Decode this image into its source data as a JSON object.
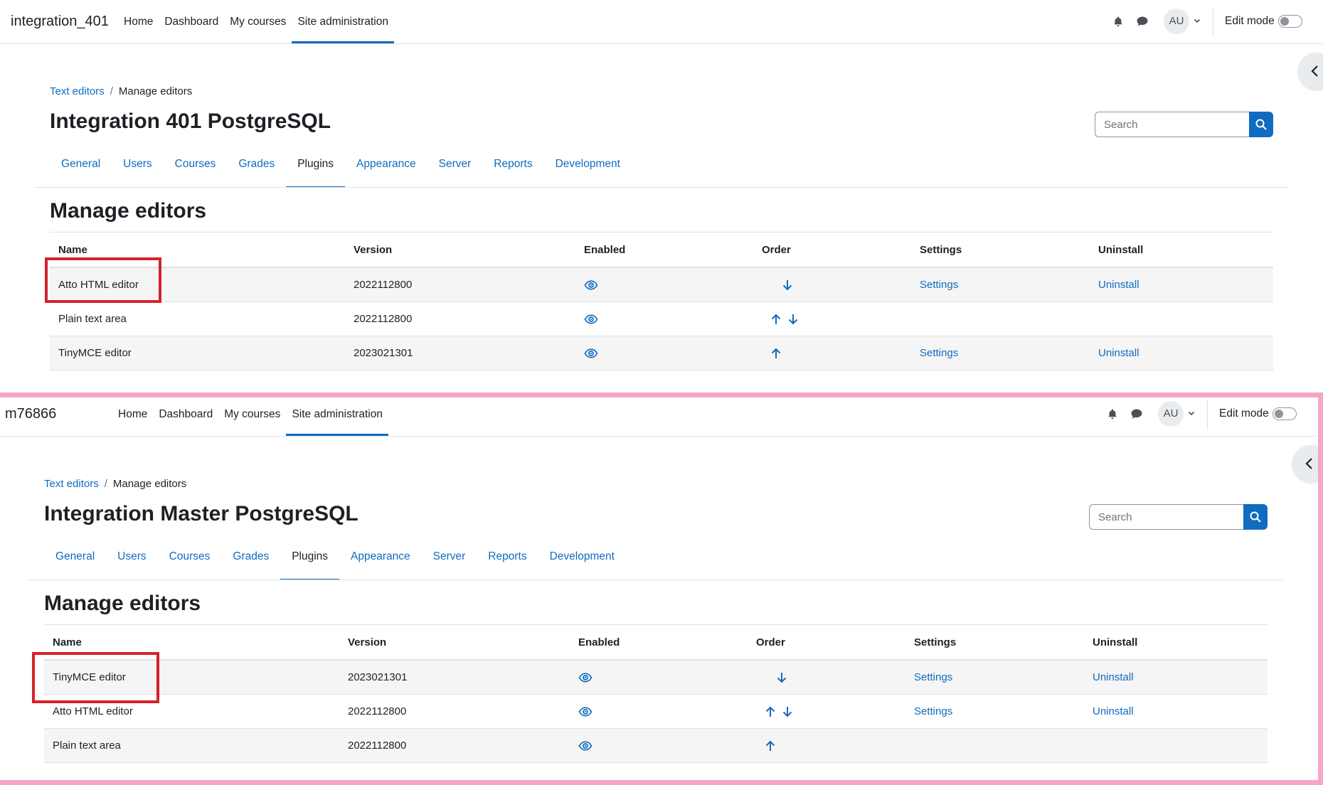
{
  "colors": {
    "accent": "#0f6cbf",
    "highlight": "#d6222a",
    "panel_border": "#f5a6c8",
    "stripe": "#f5f5f5"
  },
  "panels": [
    {
      "brand": "integration_401",
      "nav": {
        "items": [
          {
            "label": "Home"
          },
          {
            "label": "Dashboard"
          },
          {
            "label": "My courses"
          },
          {
            "label": "Site administration",
            "active": true
          }
        ]
      },
      "user_initials": "AU",
      "edit_mode_label": "Edit mode",
      "breadcrumb": {
        "parent": "Text editors",
        "separator": "/",
        "current": "Manage editors"
      },
      "page_title": "Integration 401 PostgreSQL",
      "search_placeholder": "Search",
      "tabs": [
        "General",
        "Users",
        "Courses",
        "Grades",
        "Plugins",
        "Appearance",
        "Server",
        "Reports",
        "Development"
      ],
      "active_tab": "Plugins",
      "section_title": "Manage editors",
      "table": {
        "headers": [
          "Name",
          "Version",
          "Enabled",
          "Order",
          "Settings",
          "Uninstall"
        ],
        "rows": [
          {
            "name": "Atto HTML editor",
            "version": "2022112800",
            "enabled_icon": "eye-icon",
            "order": [
              "down"
            ],
            "settings": "Settings",
            "uninstall": "Uninstall",
            "highlighted": true
          },
          {
            "name": "Plain text area",
            "version": "2022112800",
            "enabled_icon": "eye-icon",
            "order": [
              "up",
              "down"
            ],
            "settings": "",
            "uninstall": ""
          },
          {
            "name": "TinyMCE editor",
            "version": "2023021301",
            "enabled_icon": "eye-icon",
            "order": [
              "up"
            ],
            "settings": "Settings",
            "uninstall": "Uninstall"
          }
        ]
      }
    },
    {
      "brand": "m76866",
      "nav": {
        "items": [
          {
            "label": "Home"
          },
          {
            "label": "Dashboard"
          },
          {
            "label": "My courses"
          },
          {
            "label": "Site administration",
            "active": true
          }
        ]
      },
      "user_initials": "AU",
      "edit_mode_label": "Edit mode",
      "breadcrumb": {
        "parent": "Text editors",
        "separator": "/",
        "current": "Manage editors"
      },
      "page_title": "Integration Master PostgreSQL",
      "search_placeholder": "Search",
      "tabs": [
        "General",
        "Users",
        "Courses",
        "Grades",
        "Plugins",
        "Appearance",
        "Server",
        "Reports",
        "Development"
      ],
      "active_tab": "Plugins",
      "section_title": "Manage editors",
      "table": {
        "headers": [
          "Name",
          "Version",
          "Enabled",
          "Order",
          "Settings",
          "Uninstall"
        ],
        "rows": [
          {
            "name": "TinyMCE editor",
            "version": "2023021301",
            "enabled_icon": "eye-icon",
            "order": [
              "down"
            ],
            "settings": "Settings",
            "uninstall": "Uninstall",
            "highlighted": true
          },
          {
            "name": "Atto HTML editor",
            "version": "2022112800",
            "enabled_icon": "eye-icon",
            "order": [
              "up",
              "down"
            ],
            "settings": "Settings",
            "uninstall": "Uninstall"
          },
          {
            "name": "Plain text area",
            "version": "2022112800",
            "enabled_icon": "eye-icon",
            "order": [
              "up"
            ],
            "settings": "",
            "uninstall": ""
          }
        ]
      }
    }
  ]
}
